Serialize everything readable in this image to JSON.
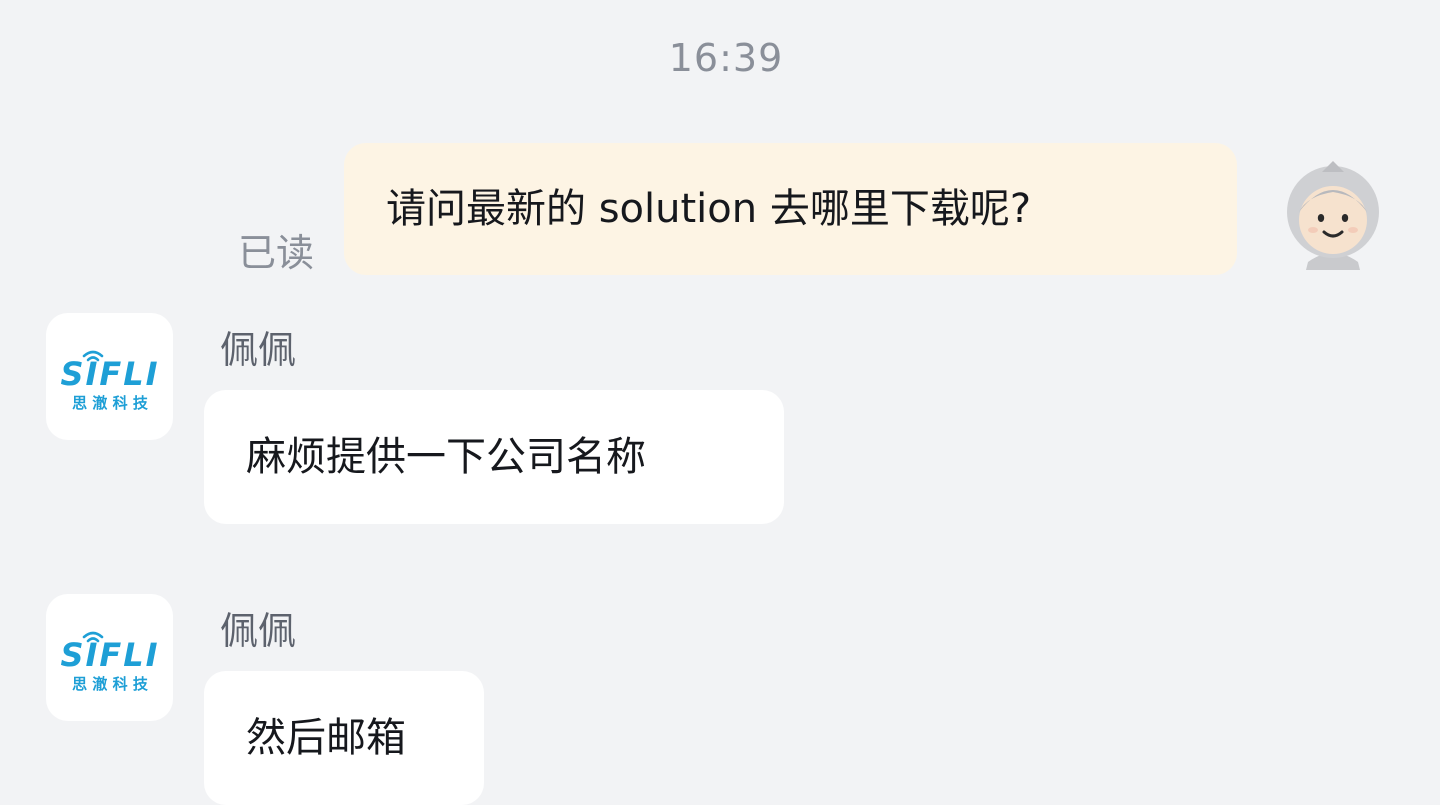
{
  "timestamp": "16:39",
  "outgoing": {
    "read_status": "已读",
    "text": "请问最新的 solution 去哪里下载呢?"
  },
  "incoming": [
    {
      "sender": "佩佩",
      "text": "麻烦提供一下公司名称"
    },
    {
      "sender": "佩佩",
      "text": "然后邮箱"
    }
  ],
  "sifli_logo": {
    "wordmark": "SIFLI",
    "tagline": "思 澈 科 技"
  },
  "colors": {
    "background": "#f2f3f5",
    "outgoing_bubble": "#fdf4e4",
    "incoming_bubble": "#ffffff",
    "logo_blue": "#1e9fd6",
    "meta_text": "#8a8f99"
  },
  "icons": {
    "self_avatar": "cartoon-hooded-character-avatar",
    "sender_avatar": "sifli-logo-avatar"
  }
}
